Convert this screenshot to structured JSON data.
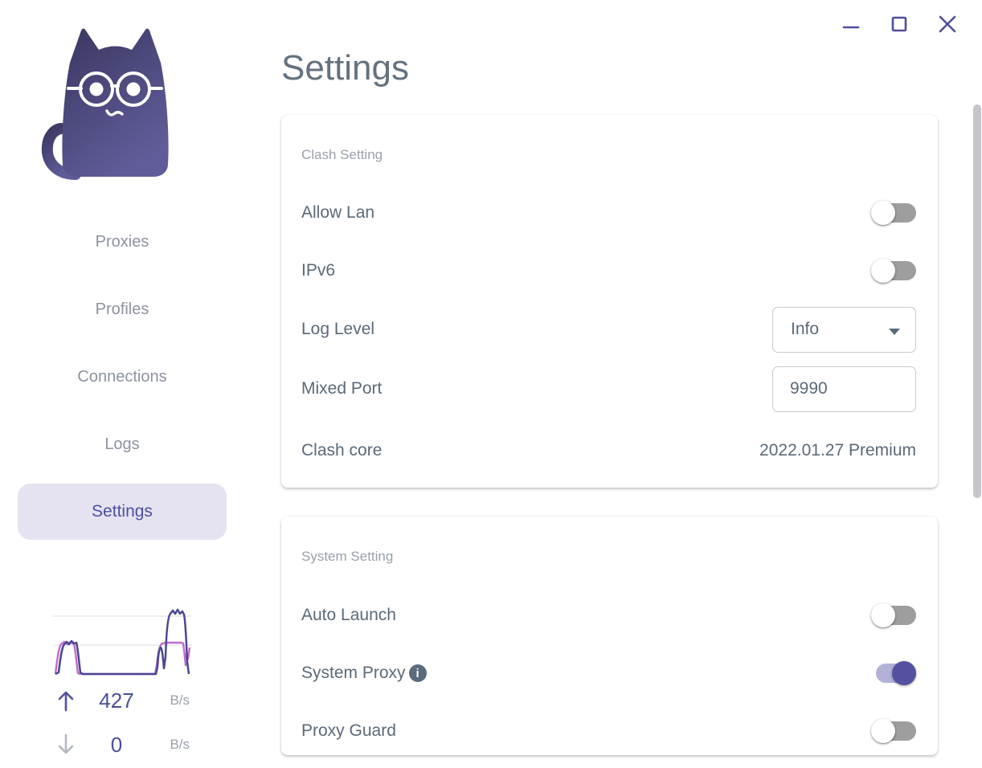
{
  "window": {
    "controls": [
      {
        "icon": "minimize-icon"
      },
      {
        "icon": "maximize-icon"
      },
      {
        "icon": "close-icon"
      }
    ]
  },
  "sidebar": {
    "logo_icon": "clash-cat-logo",
    "nav": [
      {
        "label": "Proxies",
        "active": false
      },
      {
        "label": "Profiles",
        "active": false
      },
      {
        "label": "Connections",
        "active": false
      },
      {
        "label": "Logs",
        "active": false
      },
      {
        "label": "Settings",
        "active": true
      }
    ],
    "traffic": {
      "upload": {
        "icon": "up-arrow-icon",
        "value": "427",
        "unit": "B/s"
      },
      "download": {
        "icon": "down-arrow-icon",
        "value": "0",
        "unit": "B/s"
      }
    }
  },
  "main": {
    "title": "Settings",
    "cards": [
      {
        "section": "Clash Setting",
        "rows": [
          {
            "label": "Allow Lan",
            "control": "toggle",
            "value": false
          },
          {
            "label": "IPv6",
            "control": "toggle",
            "value": false
          },
          {
            "label": "Log Level",
            "control": "select",
            "value": "Info"
          },
          {
            "label": "Mixed Port",
            "control": "input",
            "value": "9990"
          },
          {
            "label": "Clash core",
            "control": "text",
            "value": "2022.01.27 Premium"
          }
        ]
      },
      {
        "section": "System Setting",
        "rows": [
          {
            "label": "Auto Launch",
            "control": "toggle",
            "value": false
          },
          {
            "label": "System Proxy",
            "control": "toggle",
            "value": true,
            "info_icon": "info-icon",
            "info_glyph": "i"
          },
          {
            "label": "Proxy Guard",
            "control": "toggle",
            "value": false
          }
        ]
      }
    ]
  },
  "colors": {
    "accent": "#4f4c9d",
    "accent_light_track": "#b3b1d8",
    "nav_active_bg": "#e5e3f2",
    "nav_inactive_text": "#8d93a0",
    "title_text": "#64727f",
    "row_text": "#5b6a79",
    "section_text": "#9aa1ab",
    "toggle_off_track": "#9e9e9e",
    "graph_upload_line": "#4b4793",
    "graph_download_line": "#c16ace",
    "scrollbar": "#c4c6cc"
  }
}
